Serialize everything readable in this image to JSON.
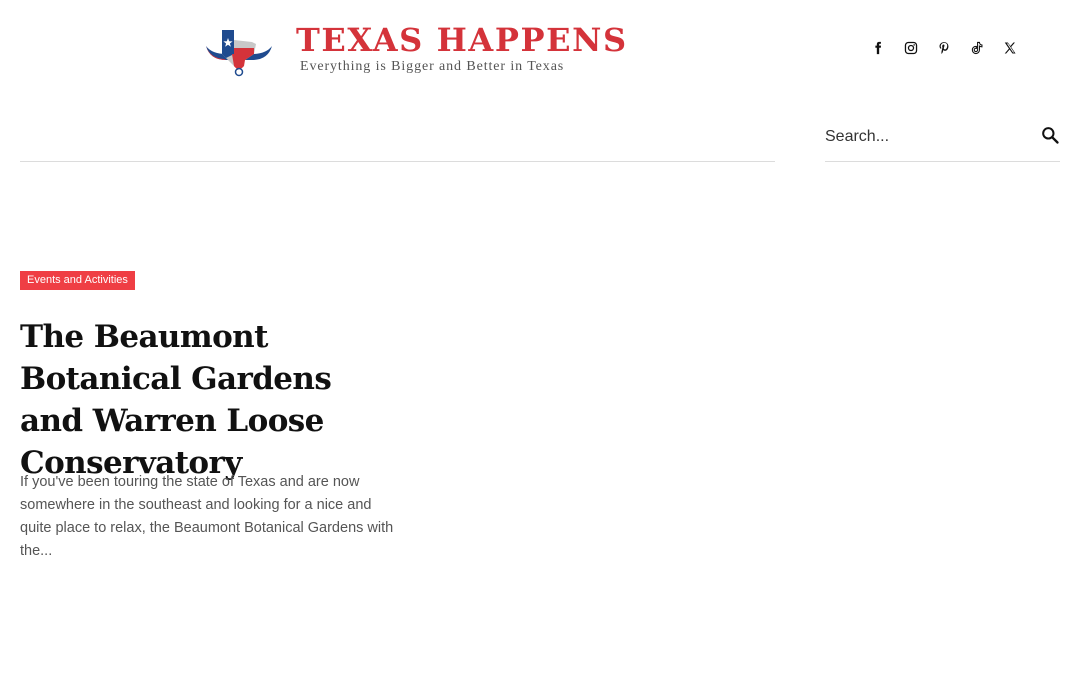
{
  "header": {
    "site_title": "TEXAS HAPPENS",
    "tagline": "Everything is Bigger and Better in Texas",
    "social": [
      {
        "name": "facebook-icon"
      },
      {
        "name": "instagram-icon"
      },
      {
        "name": "pinterest-icon"
      },
      {
        "name": "tiktok-icon"
      },
      {
        "name": "x-icon"
      }
    ]
  },
  "search": {
    "placeholder": "Search...",
    "icon": "search-icon"
  },
  "post": {
    "category": "Events and Activities",
    "title": "The Beaumont Botanical Gardens and Warren Loose Conservatory",
    "excerpt": "If you've been touring the state of Texas and are now somewhere in the southeast and looking for a nice and quite place to relax, the Beaumont Botanical Gardens with the..."
  },
  "colors": {
    "brand_red": "#d4333a",
    "category_bg": "#ef3e44",
    "texas_blue": "#1f4b8f"
  }
}
